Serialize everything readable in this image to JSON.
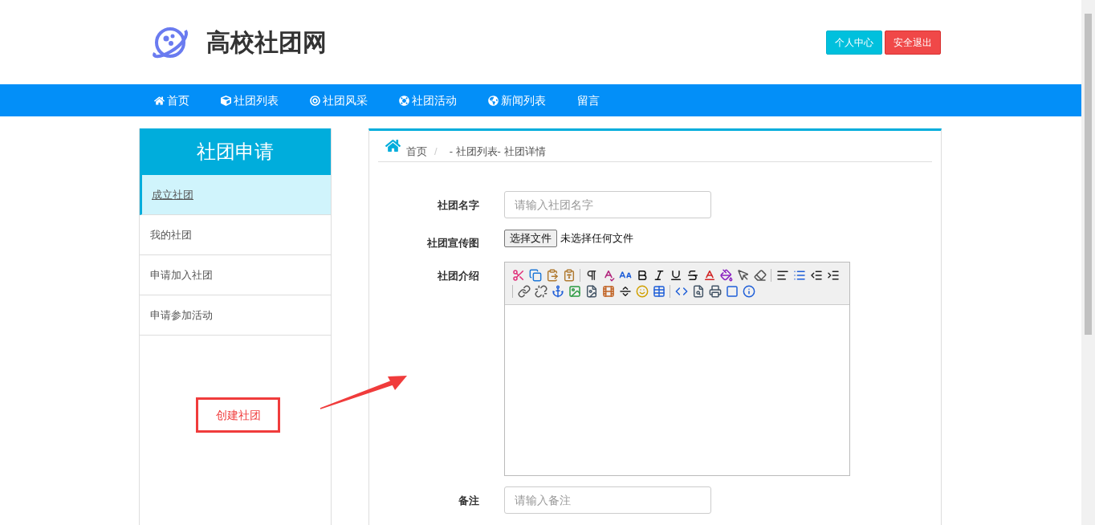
{
  "site": {
    "title": "高校社团网"
  },
  "header_buttons": [
    {
      "label": "个人中心",
      "kind": "primary"
    },
    {
      "label": "安全退出",
      "kind": "danger"
    }
  ],
  "nav": [
    {
      "label": "首页"
    },
    {
      "label": "社团列表"
    },
    {
      "label": "社团风采"
    },
    {
      "label": "社团活动"
    },
    {
      "label": "新闻列表"
    },
    {
      "label": "留言"
    }
  ],
  "sidebar": {
    "title": "社团申请",
    "items": [
      {
        "label": "成立社团",
        "selected": true
      },
      {
        "label": "我的社团",
        "selected": false
      },
      {
        "label": "申请加入社团",
        "selected": false
      },
      {
        "label": "申请参加活动",
        "selected": false
      }
    ]
  },
  "annotation": {
    "label": "创建社团"
  },
  "breadcrumb": {
    "home": "首页",
    "separator": "/",
    "current": "- 社团列表- 社团详情"
  },
  "form": {
    "fields": [
      {
        "kind": "text",
        "label": "社团名字",
        "placeholder": "请输入社团名字"
      },
      {
        "kind": "file",
        "label": "社团宣传图",
        "button": "选择文件",
        "value": "未选择任何文件"
      },
      {
        "kind": "editor",
        "label": "社团介绍"
      },
      {
        "kind": "text",
        "label": "备注",
        "placeholder": "请输入备注"
      }
    ]
  }
}
